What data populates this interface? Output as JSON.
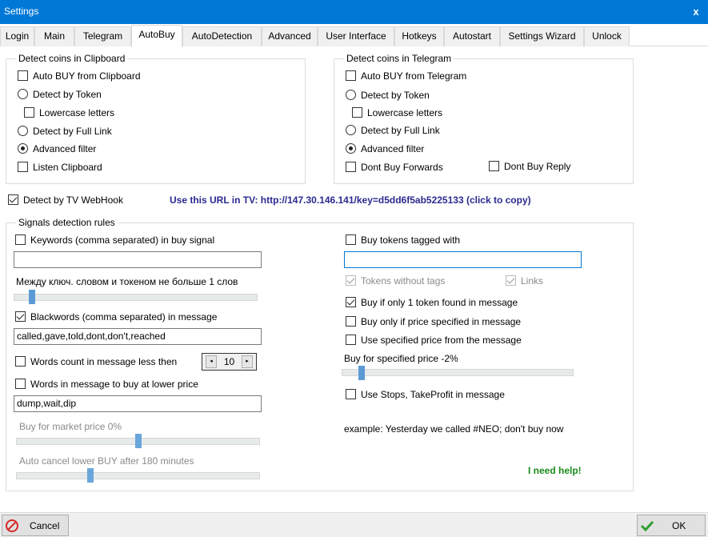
{
  "window": {
    "title": "Settings",
    "close_glyph": "x"
  },
  "tabs": [
    {
      "label": "Login"
    },
    {
      "label": "Main"
    },
    {
      "label": "Telegram"
    },
    {
      "label": "AutoBuy",
      "active": true
    },
    {
      "label": "AutoDetection"
    },
    {
      "label": "Advanced"
    },
    {
      "label": "User Interface"
    },
    {
      "label": "Hotkeys"
    },
    {
      "label": "Autostart"
    },
    {
      "label": "Settings Wizard"
    },
    {
      "label": "Unlock"
    }
  ],
  "clipboard_group": {
    "title": "Detect coins in Clipboard",
    "auto_buy": {
      "label": "Auto BUY from Clipboard",
      "checked": false
    },
    "detect_token": {
      "label": "Detect by Token",
      "checked": false
    },
    "lowercase": {
      "label": "Lowercase letters",
      "checked": false
    },
    "detect_link": {
      "label": "Detect by Full Link",
      "checked": false
    },
    "advanced_filter": {
      "label": "Advanced filter",
      "checked": true
    },
    "listen": {
      "label": "Listen Clipboard",
      "checked": false
    }
  },
  "telegram_group": {
    "title": "Detect coins in Telegram",
    "auto_buy": {
      "label": "Auto BUY from Telegram",
      "checked": false
    },
    "detect_token": {
      "label": "Detect by Token",
      "checked": false
    },
    "lowercase": {
      "label": "Lowercase letters",
      "checked": false
    },
    "detect_link": {
      "label": "Detect by Full Link",
      "checked": false
    },
    "advanced_filter": {
      "label": "Advanced filter",
      "checked": true
    },
    "dont_buy_forwards": {
      "label": "Dont Buy Forwards",
      "checked": false
    },
    "dont_buy_reply": {
      "label": "Dont Buy Reply",
      "checked": false
    }
  },
  "tv_webhook": {
    "label": "Detect by TV WebHook",
    "checked": true,
    "url_text": "Use this URL in TV: http://147.30.146.141/key=d5dd6f5ab5225133 (click to copy)"
  },
  "signals_group": {
    "title": "Signals detection rules",
    "keywords": {
      "label": "Keywords (comma separated) in buy signal",
      "checked": false,
      "value": ""
    },
    "distance": {
      "label": "Между ключ. словом и токеном не больше 1 слов",
      "value": 1
    },
    "blackwords": {
      "label": "Blackwords (comma separated) in message",
      "checked": true,
      "value": "called,gave,told,dont,don't,reached"
    },
    "words_count": {
      "label": "Words count in message less then",
      "checked": false,
      "value": "10",
      "dec": "◂",
      "inc": "▸"
    },
    "lower_price_words": {
      "label": "Words in message to buy at lower price",
      "checked": false,
      "value": "dump,wait,dip"
    },
    "market_price": {
      "label": "Buy for market price 0%",
      "value": 0
    },
    "auto_cancel": {
      "label": "Auto cancel lower BUY after 180 minutes",
      "value": 180
    },
    "tagged": {
      "label": "Buy tokens tagged with",
      "checked": false,
      "value": ""
    },
    "without_tags": {
      "label": "Tokens without tags",
      "checked": true
    },
    "links": {
      "label": "Links",
      "checked": true
    },
    "only_one": {
      "label": "Buy if only 1 token found in message",
      "checked": true
    },
    "only_price": {
      "label": "Buy only if price specified in message",
      "checked": false
    },
    "use_price": {
      "label": "Use specified price from the message",
      "checked": false
    },
    "specified_price": {
      "label": "Buy for specified price -2%",
      "value": -2
    },
    "stops": {
      "label": "Use Stops, TakeProfit in message",
      "checked": false
    },
    "example": "example: Yesterday we called #NEO; don't buy now",
    "help": "I need help!"
  },
  "buttons": {
    "cancel": "Cancel",
    "ok": "OK"
  },
  "colors": {
    "titlebar": "#0078d7",
    "link": "#2a2a8f",
    "help": "#1a8a1a",
    "slider": "#5b9bd5"
  }
}
